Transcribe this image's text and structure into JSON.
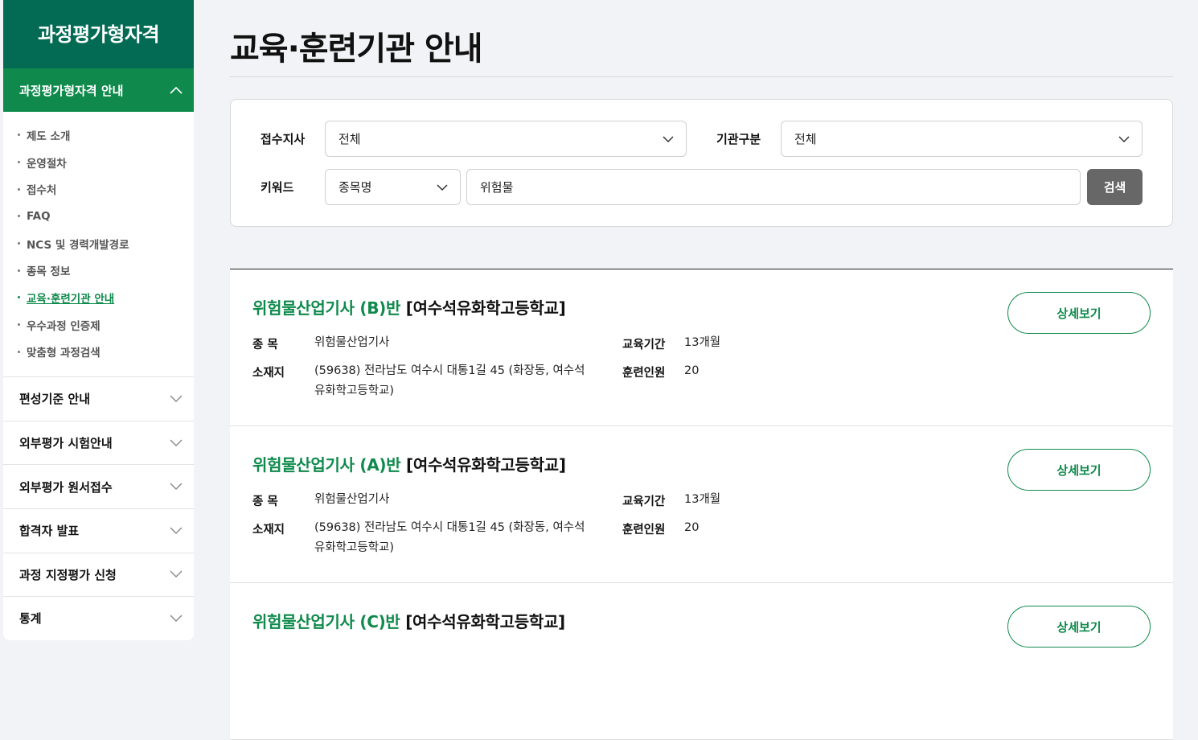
{
  "sidebar": {
    "brand": "과정평가형자격",
    "open_section": "과정평가형자격 안내",
    "sub_items": [
      {
        "label": "제도 소개",
        "active": false
      },
      {
        "label": "운영절차",
        "active": false
      },
      {
        "label": "접수처",
        "active": false
      },
      {
        "label": "FAQ",
        "active": false
      },
      {
        "label": "NCS 및 경력개발경로",
        "active": false
      },
      {
        "label": "종목 정보",
        "active": false
      },
      {
        "label": "교육·훈련기관 안내",
        "active": true
      },
      {
        "label": "우수과정 인증제",
        "active": false
      },
      {
        "label": "맞춤형 과정검색",
        "active": false
      }
    ],
    "sections": [
      "편성기준 안내",
      "외부평가 시험안내",
      "외부평가 원서접수",
      "합격자 발표",
      "과정 지정평가 신청",
      "통계"
    ]
  },
  "page": {
    "title": "교육·훈련기관 안내"
  },
  "search": {
    "branch_label": "접수지사",
    "branch_value": "전체",
    "org_type_label": "기관구분",
    "org_type_value": "전체",
    "keyword_label": "키워드",
    "keyword_type_value": "종목명",
    "keyword_value": "위험물",
    "search_button": "검색"
  },
  "results": [
    {
      "name": "위험물산업기사 (B)반",
      "org": "[여수석유화학고등학교]",
      "item_label": "종 목",
      "item_value": "위험물산업기사",
      "location_label": "소재지",
      "location_line1": "(59638) 전라남도 여수시 대통1길 45 (화장동, 여수석",
      "location_line2": "유화학고등학교)",
      "period_label": "교육기간",
      "period_value": "13개월",
      "count_label": "훈련인원",
      "count_value": "20",
      "detail_button": "상세보기"
    },
    {
      "name": "위험물산업기사 (A)반",
      "org": "[여수석유화학고등학교]",
      "item_label": "종 목",
      "item_value": "위험물산업기사",
      "location_label": "소재지",
      "location_line1": "(59638) 전라남도 여수시 대통1길 45 (화장동, 여수석",
      "location_line2": "유화학고등학교)",
      "period_label": "교육기간",
      "period_value": "13개월",
      "count_label": "훈련인원",
      "count_value": "20",
      "detail_button": "상세보기"
    },
    {
      "name": "위험물산업기사 (C)반",
      "org": "[여수석유화학고등학교]",
      "detail_button": "상세보기"
    }
  ],
  "colors": {
    "brand_dark": "#036b53",
    "brand_green": "#0f8a4c",
    "search_button": "#676767",
    "background": "#f2f3f6"
  }
}
